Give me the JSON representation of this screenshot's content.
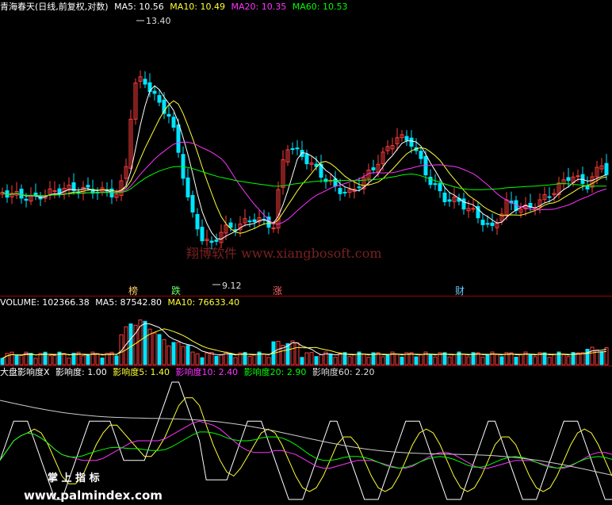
{
  "colors": {
    "background": "#000000",
    "up_candle": "#ff3b3b",
    "down_candle": "#00e5ff",
    "ma5": "#ffffff",
    "ma10": "#ffff33",
    "ma20": "#ff33ff",
    "ma60": "#00ff00",
    "divider": "#a00000",
    "watermark": "#7a2020"
  },
  "price_panel": {
    "header": {
      "title": "青海春天(日线,前复权,对数)",
      "ma5": "MA5: 10.56",
      "ma10": "MA10: 10.49",
      "ma20": "MA20: 10.35",
      "ma60": "MA60: 10.53"
    },
    "high_label": "13.40",
    "low_label": "9.12",
    "events": [
      {
        "label": "榜",
        "color": "#ffcc66"
      },
      {
        "label": "跌",
        "color": "#66ff66"
      },
      {
        "label": "涨",
        "color": "#ff6666"
      },
      {
        "label": "财",
        "color": "#66ccff"
      }
    ],
    "watermark": "翔博软件 www.xiangbosoft.com"
  },
  "volume_panel": {
    "header": {
      "volume": "VOLUME: 102366.38",
      "ma5": "MA5: 87542.80",
      "ma10": "MA10: 76633.40"
    }
  },
  "indicator_panel": {
    "header": {
      "name": "大盘影响度X",
      "v1": "影响度: 1.00",
      "v5": "影响度5: 1.40",
      "v10": "影响度10: 2.40",
      "v20": "影响度20: 2.90",
      "v60": "影响度60: 2.20"
    },
    "footer_watermark_1": "掌 上 指 标",
    "footer_watermark_2": "www.palmindex.com"
  },
  "chart_data": [
    {
      "type": "candlestick",
      "title": "青海春天(日线,前复权,对数)",
      "scale": "log",
      "ylim": [
        9.12,
        13.4
      ],
      "series": [
        {
          "name": "MA5",
          "value": 10.56
        },
        {
          "name": "MA10",
          "value": 10.49
        },
        {
          "name": "MA20",
          "value": 10.35
        },
        {
          "name": "MA60",
          "value": 10.53
        }
      ],
      "annotations": [
        "13.40",
        "9.12",
        "榜",
        "跌",
        "涨",
        "财"
      ]
    },
    {
      "type": "bar",
      "title": "VOLUME",
      "series": [
        {
          "name": "VOLUME",
          "value": 102366.38
        },
        {
          "name": "MA5",
          "value": 87542.8
        },
        {
          "name": "MA10",
          "value": 76633.4
        }
      ]
    },
    {
      "type": "line",
      "title": "大盘影响度X",
      "series": [
        {
          "name": "影响度",
          "value": 1.0
        },
        {
          "name": "影响度5",
          "value": 1.4
        },
        {
          "name": "影响度10",
          "value": 2.4
        },
        {
          "name": "影响度20",
          "value": 2.9
        },
        {
          "name": "影响度60",
          "value": 2.2
        }
      ]
    }
  ]
}
